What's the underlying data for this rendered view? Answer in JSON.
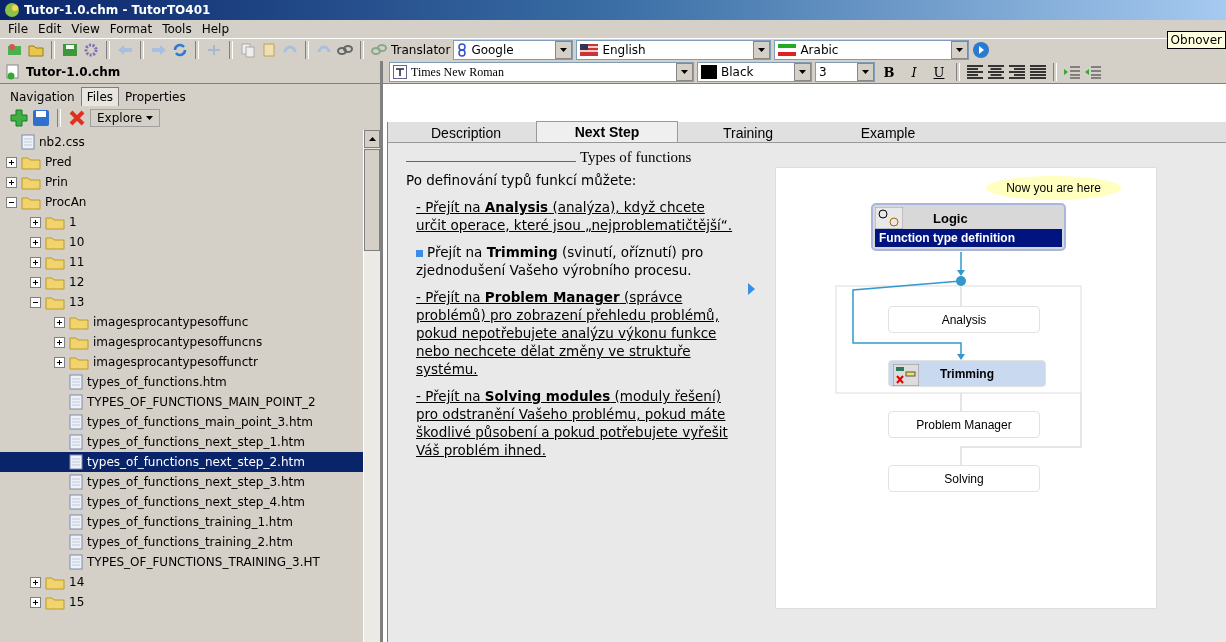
{
  "window": {
    "title": "Tutor-1.0.chm - TutorTO401"
  },
  "menu": [
    "File",
    "Edit",
    "View",
    "Format",
    "Tools",
    "Help"
  ],
  "tooltip": "Obnover",
  "translator": {
    "label": "Translator",
    "engine": "Google",
    "from": "English",
    "to": "Arabic"
  },
  "left_pane": {
    "title": "Tutor-1.0.chm",
    "tabs": [
      {
        "label": "Navigation",
        "selected": false
      },
      {
        "label": "Files",
        "selected": true
      },
      {
        "label": "Properties",
        "selected": false
      }
    ],
    "explore": "Explore",
    "tree": [
      {
        "label": "nb2.css",
        "kind": "file",
        "selected": false
      },
      {
        "label": "Pred",
        "kind": "folder",
        "expanded": false,
        "selected": false
      },
      {
        "label": "Prin",
        "kind": "folder",
        "expanded": false,
        "selected": false
      },
      {
        "label": "ProcAn",
        "kind": "folder",
        "expanded": true,
        "selected": false,
        "children": [
          {
            "label": "1",
            "kind": "folder",
            "expanded": false,
            "selected": false
          },
          {
            "label": "10",
            "kind": "folder",
            "expanded": false,
            "selected": false
          },
          {
            "label": "11",
            "kind": "folder",
            "expanded": false,
            "selected": false
          },
          {
            "label": "12",
            "kind": "folder",
            "expanded": false,
            "selected": false
          },
          {
            "label": "13",
            "kind": "folder",
            "expanded": true,
            "selected": false,
            "children": [
              {
                "label": "imagesprocantypesoffunc",
                "kind": "folder",
                "expanded": false,
                "selected": false
              },
              {
                "label": "imagesprocantypesoffuncns",
                "kind": "folder",
                "expanded": false,
                "selected": false
              },
              {
                "label": "imagesprocantypesoffunctr",
                "kind": "folder",
                "expanded": false,
                "selected": false
              },
              {
                "label": "types_of_functions.htm",
                "kind": "file",
                "selected": false
              },
              {
                "label": "TYPES_OF_FUNCTIONS_MAIN_POINT_2",
                "kind": "file",
                "selected": false
              },
              {
                "label": "types_of_functions_main_point_3.htm",
                "kind": "file",
                "selected": false
              },
              {
                "label": "types_of_functions_next_step_1.htm",
                "kind": "file",
                "selected": false
              },
              {
                "label": "types_of_functions_next_step_2.htm",
                "kind": "file",
                "selected": true
              },
              {
                "label": "types_of_functions_next_step_3.htm",
                "kind": "file",
                "selected": false
              },
              {
                "label": "types_of_functions_next_step_4.htm",
                "kind": "file",
                "selected": false
              },
              {
                "label": "types_of_functions_training_1.htm",
                "kind": "file",
                "selected": false
              },
              {
                "label": "types_of_functions_training_2.htm",
                "kind": "file",
                "selected": false
              },
              {
                "label": "TYPES_OF_FUNCTIONS_TRAINING_3.HT",
                "kind": "file",
                "selected": false
              }
            ]
          },
          {
            "label": "14",
            "kind": "folder",
            "expanded": false,
            "selected": false
          },
          {
            "label": "15",
            "kind": "folder",
            "expanded": false,
            "selected": false
          }
        ]
      }
    ]
  },
  "format_bar": {
    "font": "Times New Roman",
    "color_name": "Black",
    "size": "3",
    "styles": [
      "B",
      "I",
      "U"
    ]
  },
  "doc_tabs": [
    {
      "label": "Description",
      "selected": false
    },
    {
      "label": "Next Step",
      "selected": true
    },
    {
      "label": "Training",
      "selected": false
    },
    {
      "label": "Example",
      "selected": false
    }
  ],
  "document": {
    "heading": "Types of functions",
    "intro": "Po definování typů funkcí můžete:",
    "paragraphs": [
      {
        "kind": "link",
        "text": "- Přejít na **Analysis** (analýza), když chcete určit operace, které jsou „nejproblematičtější“."
      },
      {
        "kind": "current",
        "text": "Přejít na **Trimming** (svinutí, oříznutí) pro zjednodušení Vašeho výrobního procesu."
      },
      {
        "kind": "link",
        "text": "- Přejít na **Problem Manager** (správce problémů) pro zobrazení přehledu problémů, pokud nepotřebujete analýzu výkonu funkce nebo nechcete dělat změny ve struktuře systému."
      },
      {
        "kind": "link",
        "text": "- Přejít na **Solving modules** (moduly řešení) pro odstranění Vašeho problému, pokud máte škodlivé působení a pokud potřebujete vyřešit Váš problém ihned."
      }
    ]
  },
  "diagram": {
    "callout": "Now you are here",
    "nodes": [
      {
        "kind": "main",
        "label": "Logic",
        "subtitle": "Function type definition"
      },
      {
        "kind": "plain",
        "label": "Analysis"
      },
      {
        "kind": "active",
        "label": "Trimming"
      },
      {
        "kind": "plain",
        "label": "Problem Manager"
      },
      {
        "kind": "plain",
        "label": "Solving"
      }
    ]
  }
}
